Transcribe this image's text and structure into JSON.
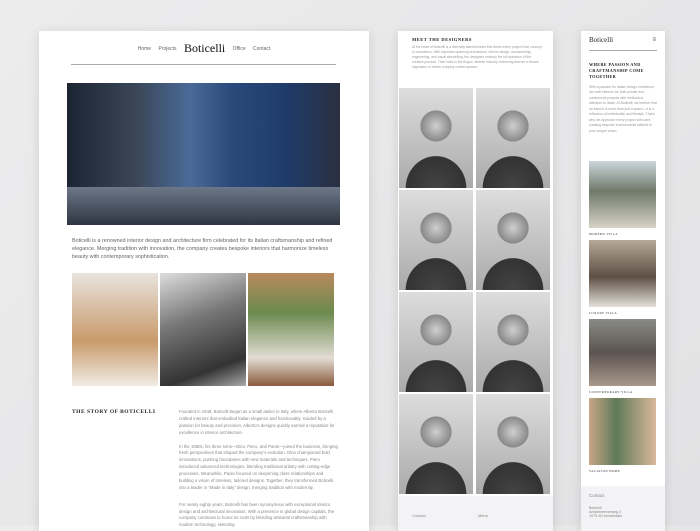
{
  "desktop": {
    "nav": {
      "home": "Home",
      "projects": "Projects",
      "logo": "Boticelli",
      "office": "Office",
      "contact": "Contact"
    },
    "intro": "Boticelli is a renowned interior design and architecture firm celebrated for its Italian craftsmanship and refined elegance. Merging tradition with innovation, the company creates bespoke interiors that harmonize timeless beauty with contemporary sophistication.",
    "story_heading": "THE STORY OF BOTICELLI",
    "story": [
      "Founded in 1948, Boticelli began as a small atelier in Italy, where Alberto Boticelli crafted interiors that embodied Italian elegance and functionality. Guided by a passion for beauty and precision, Alberto's designs quickly earned a reputation for excellence in interior architecture.",
      "In the 1980s, his three sons—Dino, Piero, and Paolo—joined the business, bringing fresh perspectives that shaped the company's evolution. Dino championed bold innovations, pushing boundaries with new materials and techniques. Piero introduced advanced technologies, blending traditional artistry with cutting-edge processes. Meanwhile, Paolo focused on deepening client relationships and building a vision of timeless, tailored designs. Together, they transformed Boticelli into a leader in \"Made in Italy\" design, merging tradition with modernity.",
      "For nearly eighty years, Boticelli has been synonymous with exceptional interior design and architectural innovation. With a presence in global design capitals, the company continues to honor its roots by blending artisanal craftsmanship with modern technology, selecting"
    ]
  },
  "designers": {
    "heading": "MEET THE DESIGNERS",
    "text": "At the heart of Boticelli is a diversely talented team that drives every project from concept to completion. With expertise spanning architecture, interior design, woodworking, engineering, and visual storytelling, the designers embody the full spectrum of the creative process. Their roles in the Bogue, diverse industry, delivering diverse a vibrant inspiration to deliver uniquely crafted spaces.",
    "footer": {
      "contact": "Contact",
      "menu": "Menu"
    }
  },
  "mobile": {
    "logo": "Boticelli",
    "heading": "WHERE PASSION AND CRAFTMANSHIP COME TOGETHER",
    "text": "With a passion for Italian design excellence, we craft interiors for both private and commercial projects with meticulous attention to detail. At Boticelli, we believe that an interior is more than just a space—it is a reflection of individuality and lifestyle. That's why we approach every project with care, creating bespoke environments tailored to your unique vision.",
    "projects": [
      "MODERN VILLA",
      "LUXURY VILLA",
      "CONTEMPORARY VILLA",
      "VACATION HOME"
    ],
    "footer": {
      "heading": "Contact",
      "name": "Boticelli",
      "street": "Amstelveenseweg 2",
      "city": "1075 XN Amsterdam"
    }
  }
}
